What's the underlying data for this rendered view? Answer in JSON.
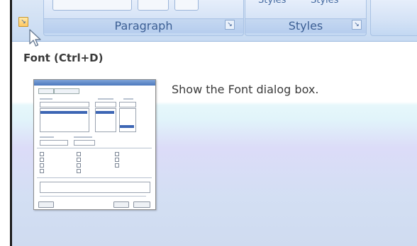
{
  "ribbon": {
    "paragraph_label": "Paragraph",
    "styles_label": "Styles",
    "cut_label_1": "Styles",
    "cut_label_2": "Styles",
    "launcher_glyph": "↘"
  },
  "tooltip": {
    "title": "Font (Ctrl+D)",
    "description": "Show the Font dialog box."
  },
  "icons": {
    "font_launcher": "dialog-launcher-icon",
    "cursor": "mouse-pointer-icon"
  },
  "colors": {
    "ribbon_label": "#3c5f94",
    "launcher_active": "#ffc760"
  }
}
